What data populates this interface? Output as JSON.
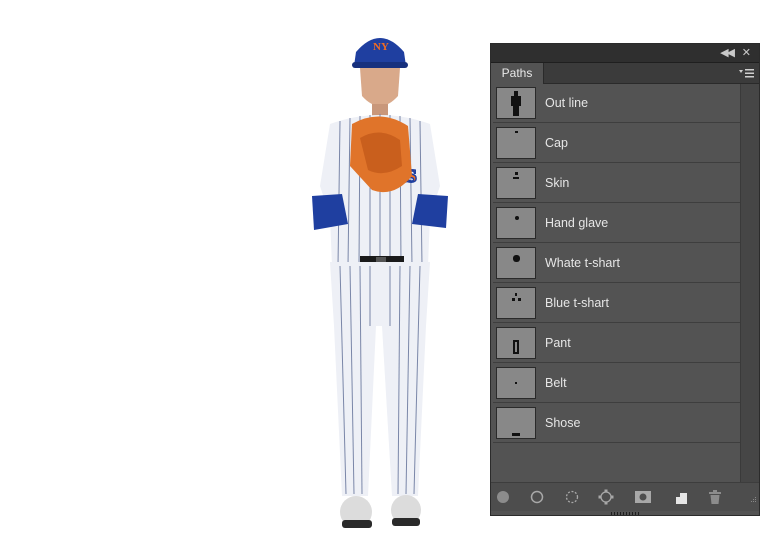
{
  "panel": {
    "tab_label": "Paths",
    "collapse_icon": "double-chevron-left-icon",
    "close_icon": "close-icon",
    "menu_icon": "panel-menu-icon"
  },
  "paths": [
    {
      "label": "Out line"
    },
    {
      "label": "Cap"
    },
    {
      "label": "Skin"
    },
    {
      "label": "Hand glave"
    },
    {
      "label": "Whate t-shart"
    },
    {
      "label": "Blue t-shart"
    },
    {
      "label": "Pant"
    },
    {
      "label": "Belt"
    },
    {
      "label": "Shose"
    }
  ],
  "toolbar": {
    "icons": [
      "fill-path-icon",
      "stroke-path-icon",
      "load-as-selection-icon",
      "make-work-path-icon",
      "add-mask-icon",
      "new-path-icon",
      "delete-path-icon"
    ]
  },
  "colors": {
    "panel_bg": "#535353",
    "titlebar_bg": "#2f2f2f",
    "thumb_bg": "#888888",
    "text": "#e6e6e6"
  }
}
